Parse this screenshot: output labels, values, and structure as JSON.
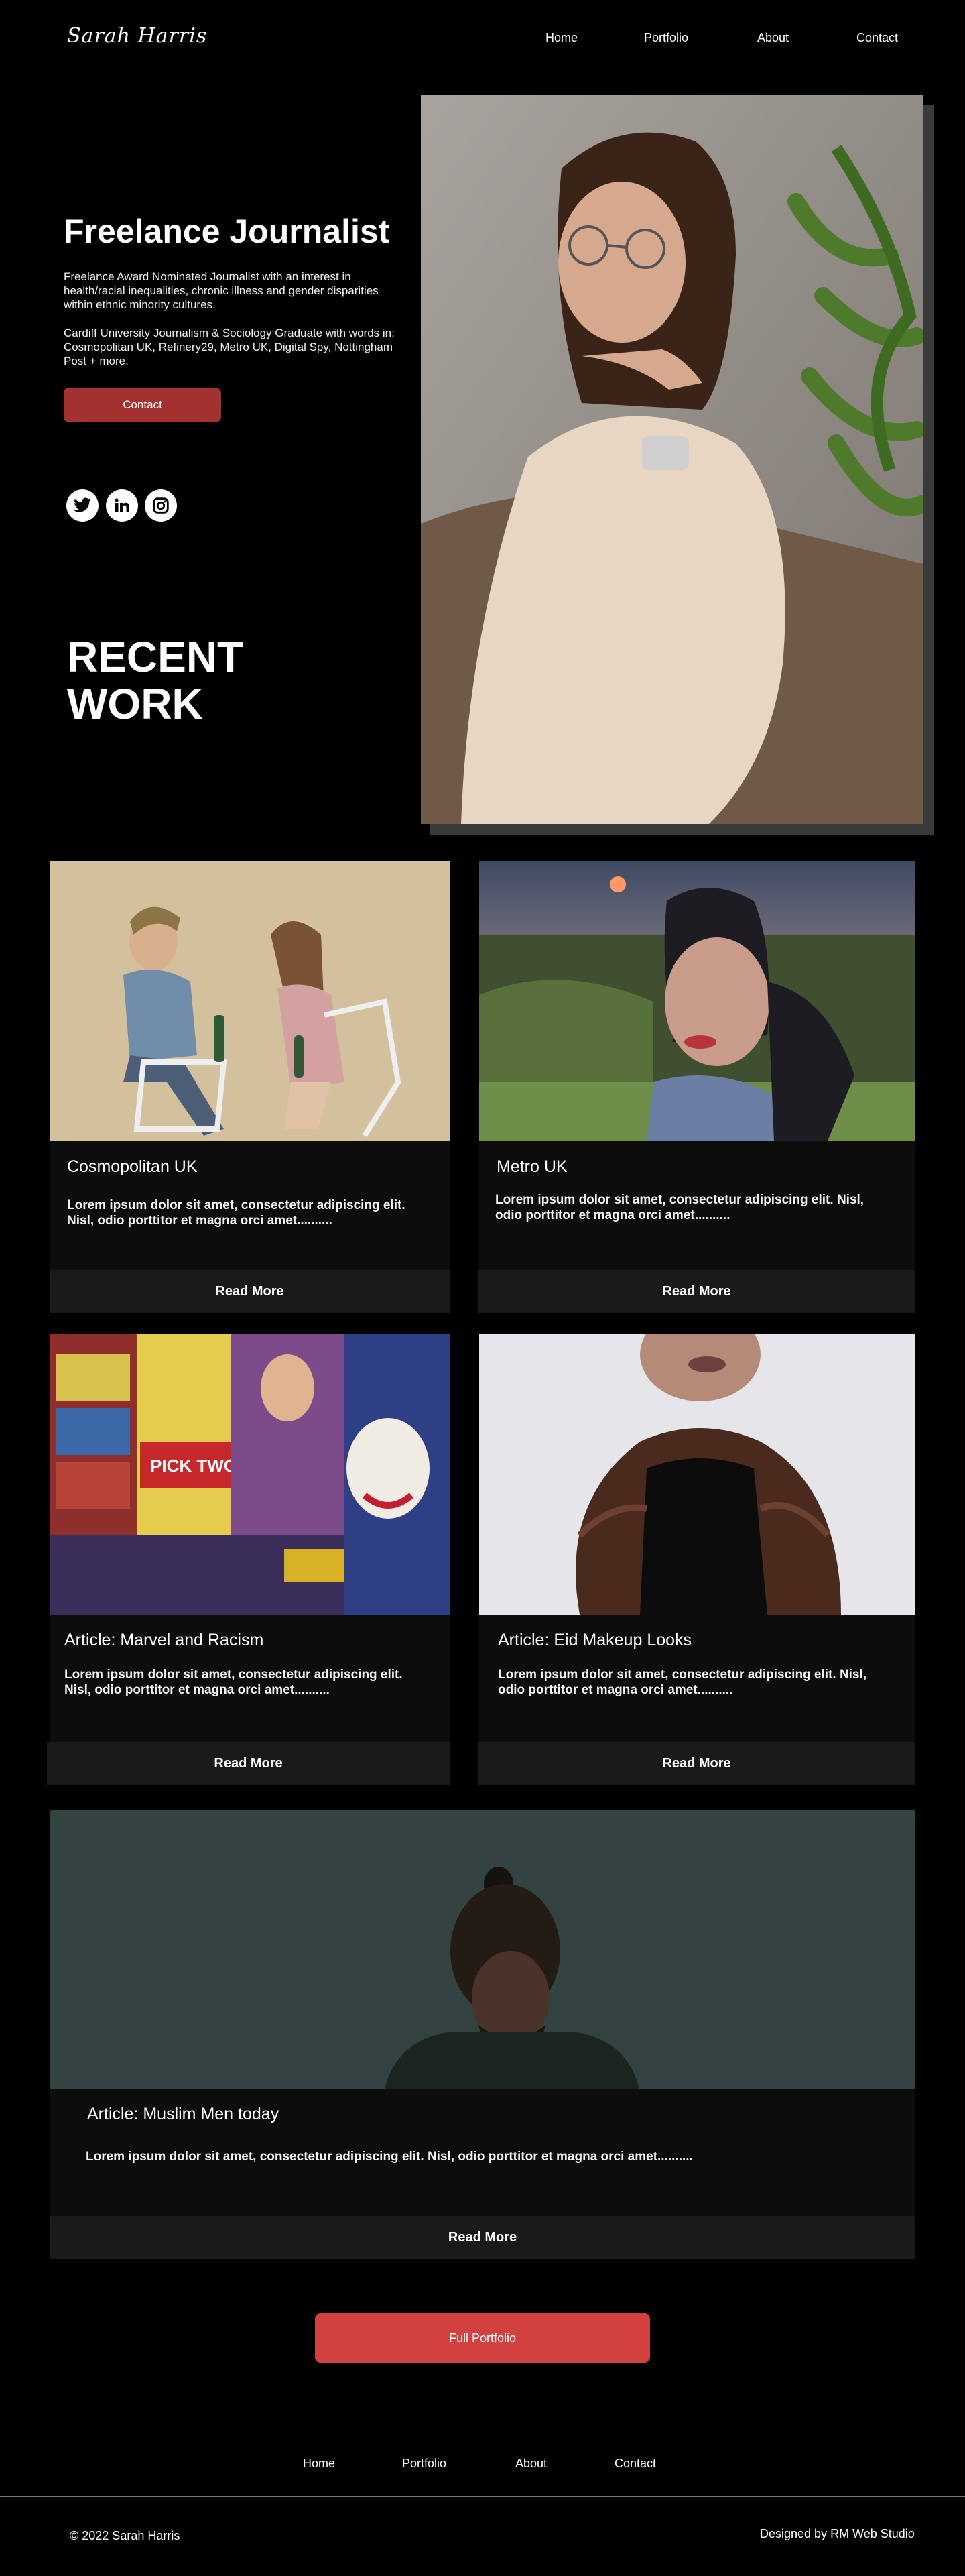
{
  "header": {
    "logo": "Sarah Harris",
    "nav": [
      "Home",
      "Portfolio",
      "About",
      "Contact"
    ]
  },
  "hero": {
    "title": "Freelance Journalist",
    "paragraph1": "Freelance Award Nominated Journalist with an interest in health/racial inequalities, chronic illness and gender disparities within ethnic minority cultures.",
    "paragraph2": "Cardiff University Journalism & Sociology Graduate with words in; Cosmopolitan UK, Refinery29, Metro UK, Digital Spy, Nottingham Post + more.",
    "contact_label": "Contact",
    "social_icons": [
      "twitter-icon",
      "linkedin-icon",
      "instagram-icon"
    ]
  },
  "recent_work": {
    "line1": "RECENT",
    "line2": "WORK"
  },
  "cards": [
    {
      "title": "Cosmopolitan UK",
      "text": "Lorem ipsum dolor sit amet, consectetur adipiscing elit. Nisl, odio porttitor et magna orci amet..........",
      "button": "Read More"
    },
    {
      "title": "Metro UK",
      "text": "Lorem ipsum dolor sit amet, consectetur adipiscing elit. Nisl, odio porttitor et magna orci amet..........",
      "button": "Read More"
    },
    {
      "title": "Article: Marvel and Racism",
      "text": "Lorem ipsum dolor sit amet, consectetur adipiscing elit. Nisl, odio porttitor et magna orci amet..........",
      "button": "Read More"
    },
    {
      "title": "Article: Eid Makeup Looks",
      "text": "Lorem ipsum dolor sit amet, consectetur adipiscing elit. Nisl, odio porttitor et magna orci amet..........",
      "button": "Read More"
    },
    {
      "title": "Article: Muslim Men today",
      "text": "Lorem ipsum dolor sit amet, consectetur adipiscing elit. Nisl, odio porttitor et magna orci amet..........",
      "button": "Read More"
    }
  ],
  "full_portfolio_label": "Full Portfolio",
  "footer": {
    "nav": [
      "Home",
      "Portfolio",
      "About",
      "Contact"
    ],
    "copyright": "© 2022 Sarah Harris",
    "designed_by": "Designed by RM Web Studio"
  },
  "colors": {
    "background": "#000000",
    "contact_button": "#a3312f",
    "full_portfolio_button": "#d24040",
    "read_more_bar": "#1c1a19"
  }
}
